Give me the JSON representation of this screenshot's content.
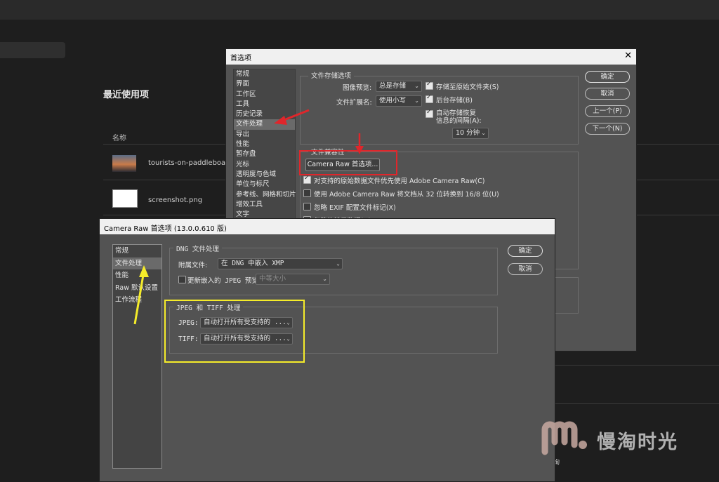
{
  "background": {
    "recent_title": "最近使用项",
    "col_name": "名称",
    "files": [
      {
        "name": "tourists-on-paddleboard-at-"
      },
      {
        "name": "screenshot.png"
      }
    ],
    "bottom_fragment": "询"
  },
  "prefs": {
    "title": "首选项",
    "close": "✕",
    "nav": [
      "常规",
      "界面",
      "工作区",
      "工具",
      "历史记录",
      "文件处理",
      "导出",
      "性能",
      "暂存盘",
      "光标",
      "透明度与色域",
      "单位与标尺",
      "参考线、网格和切片",
      "增效工具",
      "文字"
    ],
    "nav_selected": 5,
    "file_save_group": "文件存储选项",
    "image_preview_label": "图像预览:",
    "image_preview_value": "总是存储",
    "ext_label": "文件扩展名:",
    "ext_value": "使用小写",
    "save_original": "存储至原始文件夹(S)",
    "bg_save": "后台存储(B)",
    "auto_recover": "自动存储恢复",
    "auto_recover2": "信息的间隔(A):",
    "interval_value": "10 分钟",
    "compat_group": "文件兼容性",
    "camera_raw_btn": "Camera Raw 首选项...",
    "opt1": "对支持的原始数据文件优先使用 Adobe Camera Raw(C)",
    "opt2": "使用 Adobe Camera Raw 将文档从 32 位转换到 16/8 位(U)",
    "opt3": "忽略 EXIF 配置文件标记(X)",
    "opt4_partial": "忽略旋转元数据(G)",
    "buttons": {
      "ok": "确定",
      "cancel": "取消",
      "prev": "上一个(P)",
      "next": "下一个(N)"
    }
  },
  "craw": {
    "title": "Camera Raw 首选项  (13.0.0.610 版)",
    "nav": [
      "常规",
      "文件处理",
      "性能",
      "Raw 默认设置",
      "工作流程"
    ],
    "nav_selected": 1,
    "dng_group": "DNG 文件处理",
    "sidecar_label": "附属文件:",
    "sidecar_value": "在 DNG 中嵌入 XMP",
    "update_preview": "更新嵌入的 JPEG 预览:",
    "preview_size": "中等大小",
    "jt_group": "JPEG 和 TIFF 处理",
    "jpeg_label": "JPEG:",
    "jpeg_value": "自动打开所有受支持的 ...",
    "tiff_label": "TIFF:",
    "tiff_value": "自动打开所有受支持的 ...",
    "ok": "确定",
    "cancel": "取消"
  },
  "watermark": {
    "text": "慢淘时光"
  },
  "colors": {
    "red_annotation": "#e0262b",
    "yellow_annotation": "#f5ec2a"
  }
}
